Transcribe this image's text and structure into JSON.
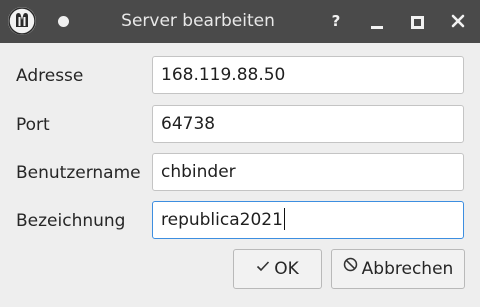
{
  "window": {
    "title": "Server bearbeiten",
    "help_glyph": "?",
    "icons": {
      "app": "mumble-logo-icon",
      "pin": "dot-icon",
      "help": "help-icon",
      "minimize": "minimize-icon",
      "maximize": "maximize-icon",
      "close": "close-icon"
    }
  },
  "form": {
    "address": {
      "label": "Adresse",
      "value": "168.119.88.50"
    },
    "port": {
      "label": "Port",
      "value": "64738"
    },
    "username": {
      "label": "Benutzername",
      "value": "chbinder"
    },
    "name": {
      "label": "Bezeichnung",
      "value": "republica2021"
    }
  },
  "buttons": {
    "ok_label": "OK",
    "cancel_label": "Abbrechen",
    "ok_icon": "check-icon",
    "cancel_icon": "cancel-icon"
  },
  "colors": {
    "titlebar": "#4a4a4a",
    "window_bg": "#eeeeee",
    "focus_border": "#3d8ee0"
  }
}
